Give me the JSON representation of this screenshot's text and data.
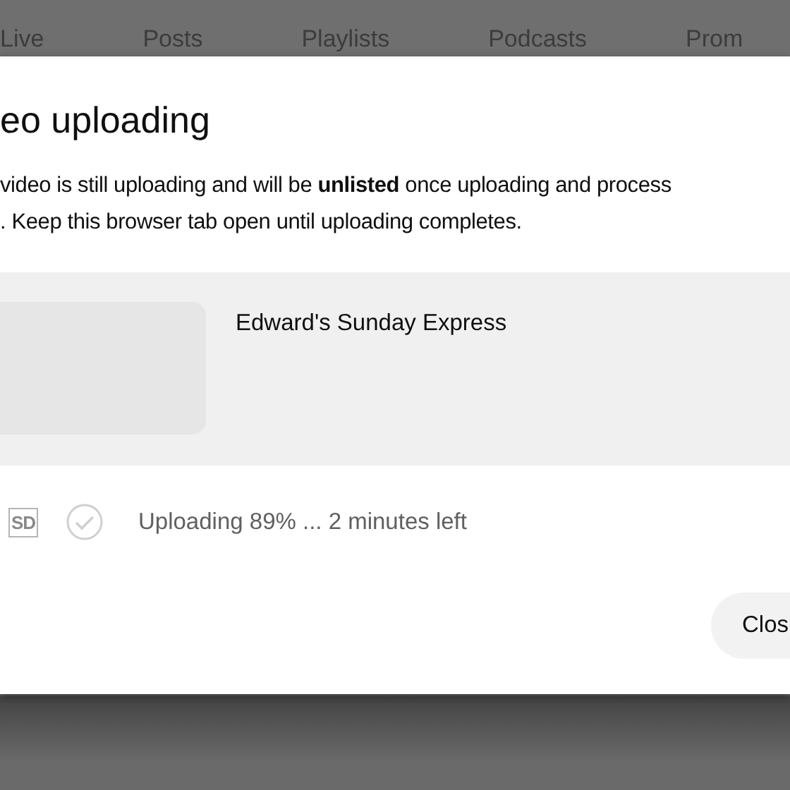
{
  "background_tabs": [
    {
      "label": "Live"
    },
    {
      "label": "Posts"
    },
    {
      "label": "Playlists"
    },
    {
      "label": "Podcasts"
    },
    {
      "label": "Prom"
    }
  ],
  "dialog": {
    "title": "eo uploading",
    "message_lines": [
      "video is still uploading and will be **unlisted** once uploading and process",
      ". Keep this browser tab open until uploading completes."
    ],
    "video": {
      "title": "Edward's Sunday Express"
    },
    "quality_badge": "SD",
    "status": "Uploading 89% ... 2 minutes left",
    "buttons": [
      "Clos"
    ]
  }
}
